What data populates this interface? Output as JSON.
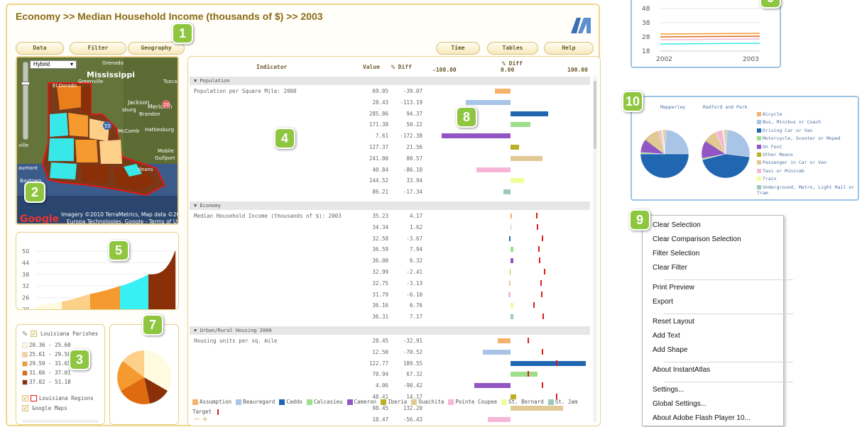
{
  "header": {
    "title": "Economy >> Median Household Income (thousands of $) >>  2003"
  },
  "toolbar_left": [
    "Data",
    "Filter",
    "Geography"
  ],
  "toolbar_right": [
    "Time",
    "Tables",
    "Help"
  ],
  "badges": [
    "1",
    "2",
    "3",
    "4",
    "5",
    "6",
    "7",
    "8",
    "9",
    "10"
  ],
  "map": {
    "type_select": "Hybrid",
    "labels": [
      "Grenada",
      "Mississippi",
      "Greenville",
      "Tusca",
      "El Dorado",
      "Jackson",
      "Meridian",
      "Brandon",
      "sburg",
      "Hattiesburg",
      "McComb",
      "Mobile",
      "Gulfport",
      "rleans",
      "aumont",
      "Baytown",
      "ville"
    ],
    "attribution_1": "Imagery ©2010  TerraMetrics, Map data ©2010",
    "attribution_2": "Europa Technologies, Google - Terms of Use",
    "google": "Google",
    "hwy_20": "20",
    "hwy_55": "55"
  },
  "table": {
    "col_indicator": "Indicator",
    "col_value": "Value",
    "col_pct": "% Diff",
    "col_diff_title": "% Diff",
    "axis": [
      "-100.00",
      "0.00",
      "100.00"
    ],
    "sections": [
      {
        "name": "Population",
        "indicator": "Population per Square Mile: 2000",
        "rows": [
          [
            "69.05",
            "-39.07"
          ],
          [
            "28.43",
            "-113.19"
          ],
          [
            "285.86",
            "94.37"
          ],
          [
            "171.38",
            "50.22"
          ],
          [
            "7.61",
            "-172.38"
          ],
          [
            "127.37",
            "21.56"
          ],
          [
            "241.00",
            "80.57"
          ],
          [
            "40.84",
            "-86.10"
          ],
          [
            "144.52",
            "33.94"
          ],
          [
            "86.21",
            "-17.34"
          ]
        ]
      },
      {
        "name": "Economy",
        "indicator": "Median Household Income (thousands of $): 2003",
        "rows": [
          [
            "35.23",
            "4.17"
          ],
          [
            "34.34",
            "1.62"
          ],
          [
            "32.58",
            "-3.67"
          ],
          [
            "36.59",
            "7.94"
          ],
          [
            "36.00",
            "6.32"
          ],
          [
            "32.99",
            "-2.41"
          ],
          [
            "32.75",
            "-3.13"
          ],
          [
            "31.79",
            "-6.10"
          ],
          [
            "36.16",
            "6.76"
          ],
          [
            "36.31",
            "7.17"
          ]
        ],
        "targets": [
          [
            "32",
            "44"
          ],
          [
            "32",
            "44"
          ],
          [
            "32",
            "44"
          ],
          [
            "32",
            "44"
          ],
          [
            "32",
            "44"
          ],
          [
            "32",
            "44"
          ],
          [
            "32",
            "44"
          ],
          [
            "32",
            "44"
          ],
          [
            "32",
            "44"
          ],
          [
            "32",
            "44"
          ]
        ]
      },
      {
        "name": "Urban/Rural Housing 2000",
        "indicator": "Housing units per sq. mile",
        "rows": [
          [
            "28.45",
            "-32.91"
          ],
          [
            "12.50",
            "-70.52"
          ],
          [
            "122.77",
            "189.55"
          ],
          [
            "70.94",
            "67.32"
          ],
          [
            "4.06",
            "-90.42"
          ],
          [
            "48.41",
            "14.17"
          ],
          [
            "98.45",
            "132.20"
          ],
          [
            "18.47",
            "-56.43"
          ]
        ]
      }
    ],
    "legend": [
      "Assumption",
      "Beauregard",
      "Caddo",
      "Calcasieu",
      "Cameron",
      "Iberia",
      "Ouachita",
      "Pointe Coupee",
      "St. Bernard",
      "St. Jam"
    ],
    "legend_colors": [
      "#f5b26b",
      "#a8c4e6",
      "#2166b0",
      "#9ddf8a",
      "#9155c4",
      "#b8b020",
      "#e2c894",
      "#f7b6d8",
      "#eeff99",
      "#9cc8c0"
    ],
    "target_label": "Target",
    "zoom": "− +"
  },
  "income_legend": {
    "title": "Louisiana Parishes",
    "ranges": [
      "20.36 - 25.60",
      "25.61 - 29.58",
      "29.59 - 31.65",
      "31.66 - 37.01",
      "37.02 - 51.18"
    ],
    "colors": [
      "#fffbe0",
      "#fdd08a",
      "#f59a2e",
      "#e06a10",
      "#8a3008"
    ],
    "regions": "Louisiana Regions",
    "google": "Google Maps"
  },
  "bar_chart": {
    "yticks": [
      "50",
      "44",
      "38",
      "32",
      "26",
      "20"
    ]
  },
  "line_chart": {
    "type": "line",
    "yticks": [
      "48",
      "38",
      "28",
      "18"
    ],
    "x": [
      "2002",
      "2003"
    ]
  },
  "pie_chart": {
    "labels": [
      "Mapperley",
      "Radford and Park"
    ],
    "legend": [
      "Bicycle",
      "Bus, Minibus or Coach",
      "Driving Car or Van",
      "Motorcycle, Scooter or Moped",
      "On Foot",
      "Other Means",
      "Passenger in Car or Van",
      "Taxi or Minicab",
      "Train",
      "Underground, Metro, Light Rail or Tram"
    ],
    "colors": [
      "#f5b26b",
      "#a8c4e6",
      "#2166b0",
      "#9ddf8a",
      "#9155c4",
      "#b8b020",
      "#e2c894",
      "#f7b6d8",
      "#eeff99",
      "#9cc8c0"
    ]
  },
  "context_menu": [
    [
      "Clear Selection",
      "Clear Comparison Selection",
      "Filter Selection",
      "Clear Filter"
    ],
    [
      "Print Preview",
      "Export"
    ],
    [
      "Reset Layout",
      "Add Text",
      "Add Shape"
    ],
    [
      "About InstantAtlas"
    ],
    [
      "Settings...",
      "Global Settings...",
      "About Adobe Flash Player 10..."
    ]
  ]
}
